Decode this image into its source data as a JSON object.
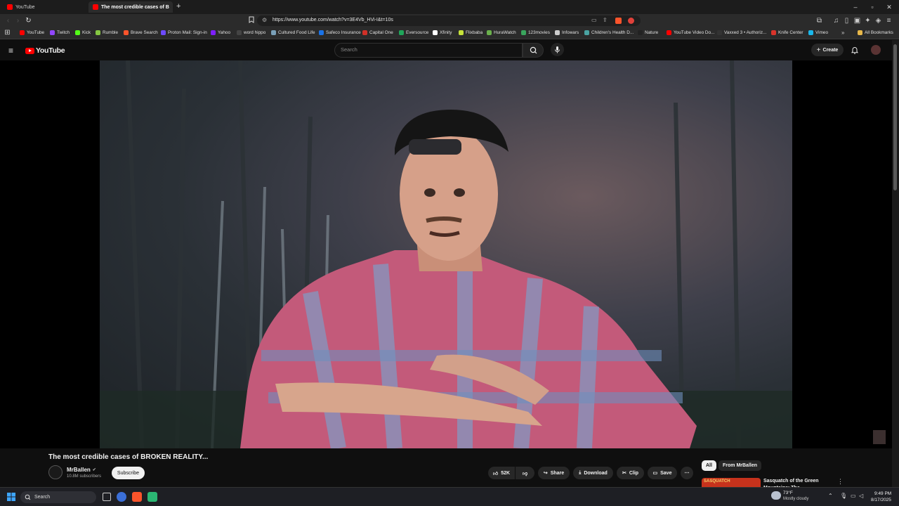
{
  "browser": {
    "tabs": [
      {
        "label": "YouTube",
        "active": false
      },
      {
        "label": "The most credible cases of B",
        "active": true
      }
    ],
    "new_tab": "+",
    "url": "https://www.youtube.com/watch?v=3E4Vb_HVi-I&t=10s",
    "bookmarks": [
      {
        "label": "YouTube",
        "color": "#ff0000"
      },
      {
        "label": "Twitch",
        "color": "#9146ff"
      },
      {
        "label": "Kick",
        "color": "#53fc18"
      },
      {
        "label": "Rumble",
        "color": "#85c742"
      },
      {
        "label": "Brave Search",
        "color": "#fb542b"
      },
      {
        "label": "Proton Mail: Sign-in",
        "color": "#6d4aff"
      },
      {
        "label": "Yahoo",
        "color": "#7e1fff"
      },
      {
        "label": "word hippo",
        "color": "#444444"
      },
      {
        "label": "Cultured Food Life",
        "color": "#7aa0b8"
      },
      {
        "label": "Safeco Insurance",
        "color": "#1a73e8"
      },
      {
        "label": "Capital One",
        "color": "#d03027"
      },
      {
        "label": "Eversource",
        "color": "#1fa65a"
      },
      {
        "label": "Xfinity",
        "color": "#ffffff"
      },
      {
        "label": "Flixbaba",
        "color": "#c6e23a"
      },
      {
        "label": "HuraWatch",
        "color": "#6ab04c"
      },
      {
        "label": "123movies",
        "color": "#3aa55d"
      },
      {
        "label": "Infowars",
        "color": "#cccccc"
      },
      {
        "label": "Children's Health D...",
        "color": "#4aa3a2"
      },
      {
        "label": "Nature",
        "color": "#222222"
      },
      {
        "label": "YouTube Video Do...",
        "color": "#ff0000"
      },
      {
        "label": "Vaxxed 3 • Authoriz...",
        "color": "#333333"
      },
      {
        "label": "Knife Center",
        "color": "#d9342b"
      },
      {
        "label": "Vimeo",
        "color": "#1ab7ea"
      }
    ],
    "all_bookmarks": "All Bookmarks"
  },
  "youtube": {
    "logo_text": "YouTube",
    "search_placeholder": "Search",
    "create_label": "Create"
  },
  "video": {
    "title": "The most credible cases of BROKEN REALITY...",
    "channel": "MrBallen",
    "subscribers": "10.8M subscribers",
    "subscribe_label": "Subscribe",
    "likes": "52K",
    "share_label": "Share",
    "download_label": "Download",
    "clip_label": "Clip",
    "save_label": "Save"
  },
  "sidebar": {
    "chips": [
      "All",
      "From MrBallen"
    ],
    "recommended": {
      "title": "Sasquatch of the Green Mountains: The Appalachian...",
      "thumb_text": "SASQUATCH"
    }
  },
  "taskbar": {
    "search_label": "Search",
    "weather_temp": "73°F",
    "weather_desc": "Mostly cloudy",
    "time": "9:49 PM",
    "date": "8/17/2025"
  }
}
